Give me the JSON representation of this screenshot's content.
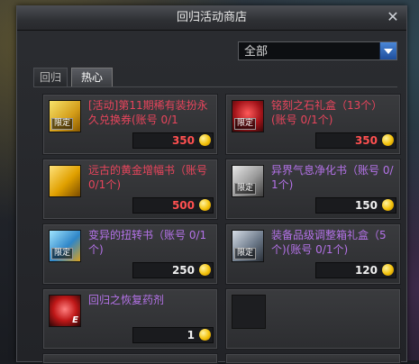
{
  "window": {
    "title": "回归活动商店"
  },
  "filter": {
    "selected": "全部"
  },
  "tabs": [
    {
      "label": "回归",
      "active": false
    },
    {
      "label": "热心",
      "active": true
    }
  ],
  "colors": {
    "red_name": "#e8455c",
    "violet_name": "#b472e8",
    "red_price": "#ff5050",
    "accent": "#2b63b8"
  },
  "items": [
    {
      "name": "[活动]第11期稀有装扮永久兑换券(账号 0/1",
      "price": "350",
      "tag": "限定",
      "name_color": "red",
      "price_color": "red",
      "icon": "ticket-icon"
    },
    {
      "name": "铭刻之石礼盒（13个）(账号 0/1个)",
      "price": "350",
      "tag": "限定",
      "name_color": "red",
      "price_color": "red",
      "icon": "stone-box-icon"
    },
    {
      "name": "远古的黄金增幅书（账号 0/1个)",
      "price": "500",
      "tag": "",
      "name_color": "red",
      "price_color": "red",
      "icon": "gold-book-icon"
    },
    {
      "name": "异界气息净化书（账号 0/1个)",
      "price": "150",
      "tag": "限定",
      "name_color": "violet",
      "price_color": "white",
      "icon": "purify-book-icon"
    },
    {
      "name": "变异的扭转书（账号 0/1个)",
      "price": "250",
      "tag": "限定",
      "name_color": "violet",
      "price_color": "white",
      "icon": "twist-book-icon"
    },
    {
      "name": "装备品级调整箱礼盒（5个)(账号 0/1个)",
      "price": "120",
      "tag": "限定",
      "name_color": "violet",
      "price_color": "white",
      "icon": "grade-box-icon"
    },
    {
      "name": "回归之恢复药剂",
      "price": "1",
      "tag": "E",
      "name_color": "violet",
      "price_color": "white",
      "icon": "potion-icon"
    }
  ]
}
